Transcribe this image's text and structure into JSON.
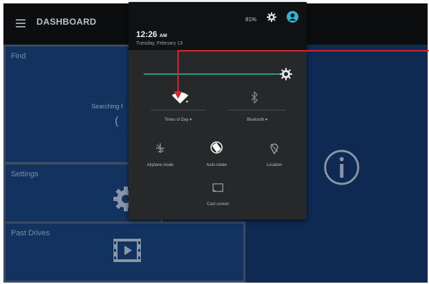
{
  "app_bar": {
    "title": "DASHBOARD",
    "menu_icon": "menu-icon"
  },
  "tiles": {
    "find": {
      "title": "Find",
      "status": "Searching f",
      "spinner": "("
    },
    "settings": {
      "title": "Settings",
      "icon": "gear-icon"
    },
    "past_drives": {
      "title": "Past Drives",
      "icon": "film-icon"
    },
    "info_icon": "info-icon"
  },
  "shade": {
    "battery": "81%",
    "time": "12:26",
    "ampm": "AM",
    "date": "Tuesday, February 13",
    "brightness_level": 0.96,
    "tiles": [
      {
        "label": "Times of Day ▾",
        "icon": "wifi-icon"
      },
      {
        "label": "Bluetooth ▾",
        "icon": "bluetooth-icon"
      },
      {
        "label": "Airplane mode",
        "icon": "airplane-icon"
      },
      {
        "label": "Auto-rotate",
        "icon": "rotate-icon"
      },
      {
        "label": "Location",
        "icon": "location-icon"
      },
      {
        "label": "Cast screen",
        "icon": "cast-icon"
      }
    ]
  },
  "colors": {
    "app_bar": "#0c0d0f",
    "dashboard": "#0e2a52",
    "shade": "#262829",
    "accent": "#2fb4d6",
    "slider": "#2a9c8c",
    "annotation": "#d7282f"
  }
}
